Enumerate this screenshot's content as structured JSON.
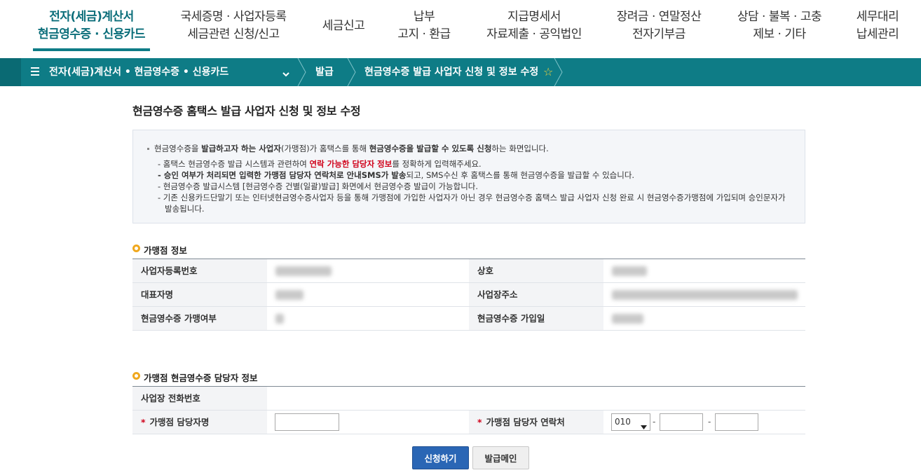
{
  "nav": {
    "items": [
      {
        "line1": "전자(세금)계산서",
        "line2": "현금영수증 · 신용카드",
        "active": true
      },
      {
        "line1": "국세증명 · 사업자등록",
        "line2": "세금관련 신청/신고"
      },
      {
        "line1": "세금신고",
        "line2": ""
      },
      {
        "line1": "납부",
        "line2": "고지 · 환급"
      },
      {
        "line1": "지급명세서",
        "line2": "자료제출 · 공익법인"
      },
      {
        "line1": "장려금 · 연말정산",
        "line2": "전자기부금"
      },
      {
        "line1": "상담 · 불복 · 고충",
        "line2": "제보 · 기타"
      },
      {
        "line1": "세무대리",
        "line2": "납세관리"
      }
    ]
  },
  "breadcrumb": {
    "menu": "전자(세금)계산서 • 현금영수증 • 신용카드",
    "level2": "발급",
    "level3": "현금영수증 발급 사업자 신청 및 정보 수정",
    "star": "☆"
  },
  "page_title": "현금영수증 홈택스 발급 사업자 신청 및 정보 수정",
  "notice": {
    "lead_a": "현금영수증을 ",
    "lead_b": "발급하고자 하는 사업자",
    "lead_c": "(가맹점)가 홈택스를 통해 ",
    "lead_d": "현금영수증을 발급할 수 있도록 신청",
    "lead_e": "하는 화면입니다.",
    "l1_a": "- 홈택스 현금영수증 발급 시스템과 관련하여 ",
    "l1_b": "연락 가능한 담당자 정보",
    "l1_c": "를 정확하게 입력해주세요.",
    "l2_a": "- 승인 여부가 처리되면 입력한 가맹점 담당자 연락처로 안내SMS가 발송",
    "l2_b": "되고, SMS수신 후 홈택스를 통해 현금영수증을 발급할 수 있습니다.",
    "l3": "- 현금영수증 발급시스템 [현금영수증 건별(일괄)발급] 화면에서 현금영수증 발급이 가능합니다.",
    "l4": "- 기존 신용카드단말기 또는 인터넷현금영수증사업자 등을 통해 가맹점에 가입한 사업자가 아닌 경우 현금영수증 홈택스 발급 사업자 신청 완료 시 현금영수증가맹점에 가입되며 승인문자가 발송됩니다."
  },
  "merchant_section": {
    "title": "가맹점 정보",
    "labels": {
      "biz_no": "사업자등록번호",
      "company": "상호",
      "ceo": "대표자명",
      "address": "사업장주소",
      "joined": "현금영수증 가맹여부",
      "join_date": "현금영수증 가입일"
    }
  },
  "contact_section": {
    "title": "가맹점 현금영수증 담당자 정보",
    "labels": {
      "phone": "사업장 전화번호",
      "manager": "가맹점 담당자명",
      "manager_phone": "가맹점 담당자 연락처"
    },
    "required_mark": "*",
    "phone_prefix": "010",
    "dash": "-"
  },
  "buttons": {
    "submit": "신청하기",
    "issue_main": "발급메인"
  },
  "colors": {
    "accent": "#0e7c86",
    "primary_button": "#2a66b5",
    "required": "#d0021b",
    "bullet": "#f0a81e"
  }
}
